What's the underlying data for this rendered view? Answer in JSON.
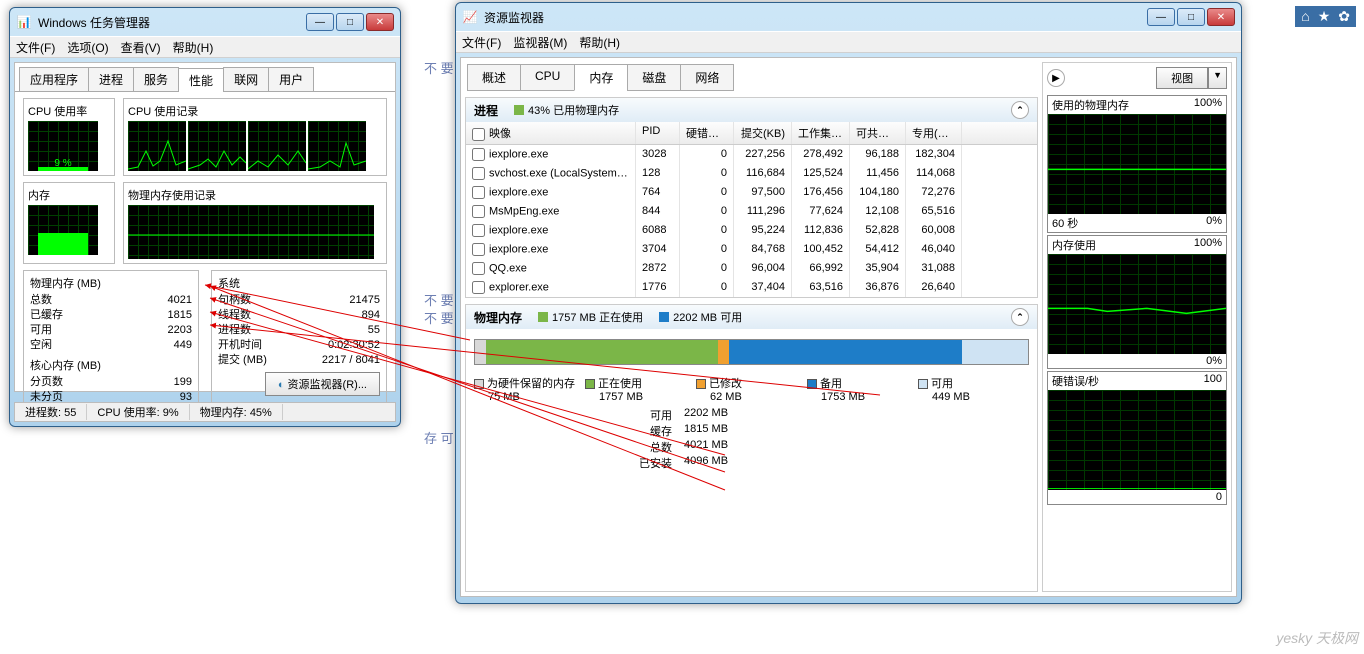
{
  "bg_texts": [
    "不 要",
    "不 要",
    "不 要",
    "存 可"
  ],
  "topicons_title": "",
  "watermark": "yesky 天极网",
  "task_manager": {
    "title": "Windows 任务管理器",
    "menu": [
      "文件(F)",
      "选项(O)",
      "查看(V)",
      "帮助(H)"
    ],
    "tabs": [
      "应用程序",
      "进程",
      "服务",
      "性能",
      "联网",
      "用户"
    ],
    "active_tab": 3,
    "cpu_usage_label": "CPU 使用率",
    "cpu_usage_value": "9 %",
    "cpu_history_label": "CPU 使用记录",
    "mem_label": "内存",
    "mem_value": "1.77 GB",
    "mem_history_label": "物理内存使用记录",
    "phys_mem_header": "物理内存 (MB)",
    "phys_mem": [
      {
        "k": "总数",
        "v": "4021"
      },
      {
        "k": "已缓存",
        "v": "1815"
      },
      {
        "k": "可用",
        "v": "2203"
      },
      {
        "k": "空闲",
        "v": "449"
      }
    ],
    "kernel_mem_header": "核心内存 (MB)",
    "kernel_mem": [
      {
        "k": "分页数",
        "v": "199"
      },
      {
        "k": "未分页",
        "v": "93"
      }
    ],
    "system_header": "系统",
    "system": [
      {
        "k": "句柄数",
        "v": "21475"
      },
      {
        "k": "线程数",
        "v": "894"
      },
      {
        "k": "进程数",
        "v": "55"
      },
      {
        "k": "开机时间",
        "v": "0:02:30:52"
      },
      {
        "k": "提交 (MB)",
        "v": "2217 / 8041"
      }
    ],
    "res_mon_btn": "资源监视器(R)...",
    "status": [
      {
        "k": "进程数:",
        "v": "55"
      },
      {
        "k": "CPU 使用率:",
        "v": "9%"
      },
      {
        "k": "物理内存:",
        "v": "45%"
      }
    ]
  },
  "resource_monitor": {
    "title": "资源监视器",
    "menu": [
      "文件(F)",
      "监视器(M)",
      "帮助(H)"
    ],
    "tabs": [
      "概述",
      "CPU",
      "内存",
      "磁盘",
      "网络"
    ],
    "active_tab": 2,
    "proc_section_title": "进程",
    "proc_usage": "43% 已用物理内存",
    "columns": [
      "映像",
      "PID",
      "硬错误/...",
      "提交(KB)",
      "工作集(...",
      "可共享(...",
      "专用(KB)"
    ],
    "rows": [
      {
        "img": "iexplore.exe",
        "pid": "3028",
        "hf": "0",
        "cm": "227,256",
        "ws": "278,492",
        "sh": "96,188",
        "pv": "182,304"
      },
      {
        "img": "svchost.exe (LocalSystemN...",
        "pid": "128",
        "hf": "0",
        "cm": "116,684",
        "ws": "125,524",
        "sh": "11,456",
        "pv": "114,068"
      },
      {
        "img": "iexplore.exe",
        "pid": "764",
        "hf": "0",
        "cm": "97,500",
        "ws": "176,456",
        "sh": "104,180",
        "pv": "72,276"
      },
      {
        "img": "MsMpEng.exe",
        "pid": "844",
        "hf": "0",
        "cm": "111,296",
        "ws": "77,624",
        "sh": "12,108",
        "pv": "65,516"
      },
      {
        "img": "iexplore.exe",
        "pid": "6088",
        "hf": "0",
        "cm": "95,224",
        "ws": "112,836",
        "sh": "52,828",
        "pv": "60,008"
      },
      {
        "img": "iexplore.exe",
        "pid": "3704",
        "hf": "0",
        "cm": "84,768",
        "ws": "100,452",
        "sh": "54,412",
        "pv": "46,040"
      },
      {
        "img": "QQ.exe",
        "pid": "2872",
        "hf": "0",
        "cm": "96,004",
        "ws": "66,992",
        "sh": "35,904",
        "pv": "31,088"
      },
      {
        "img": "explorer.exe",
        "pid": "1776",
        "hf": "0",
        "cm": "37,404",
        "ws": "63,516",
        "sh": "36,876",
        "pv": "26,640"
      }
    ],
    "phys_section_title": "物理内存",
    "phys_in_use": "1757 MB 正在使用",
    "phys_avail": "2202 MB 可用",
    "bar_colors": {
      "hw": "#d8d8d8",
      "inuse": "#7bb648",
      "mod": "#f0a030",
      "standby": "#1e7dc8",
      "free": "#cfe3f3"
    },
    "bar_segments": [
      {
        "key": "hw",
        "pct": 2
      },
      {
        "key": "inuse",
        "pct": 42
      },
      {
        "key": "mod",
        "pct": 2
      },
      {
        "key": "standby",
        "pct": 42
      },
      {
        "key": "free",
        "pct": 12
      }
    ],
    "legend": [
      {
        "key": "hw",
        "label": "为硬件保留的内存",
        "val": "75 MB"
      },
      {
        "key": "inuse",
        "label": "正在使用",
        "val": "1757 MB"
      },
      {
        "key": "mod",
        "label": "已修改",
        "val": "62 MB"
      },
      {
        "key": "standby",
        "label": "备用",
        "val": "1753 MB"
      },
      {
        "key": "free",
        "label": "可用",
        "val": "449 MB"
      }
    ],
    "summary": [
      {
        "k": "可用",
        "v": "2202 MB"
      },
      {
        "k": "缓存",
        "v": "1815 MB"
      },
      {
        "k": "总数",
        "v": "4021 MB"
      },
      {
        "k": "已安装",
        "v": "4096 MB"
      }
    ],
    "right_view_label": "视图",
    "graphs": [
      {
        "title": "使用的物理内存",
        "right": "100%",
        "foot_l": "60 秒",
        "foot_r": "0%"
      },
      {
        "title": "内存使用",
        "right": "100%",
        "foot_l": "",
        "foot_r": "0%"
      },
      {
        "title": "硬错误/秒",
        "right": "100",
        "foot_l": "",
        "foot_r": "0"
      }
    ]
  }
}
